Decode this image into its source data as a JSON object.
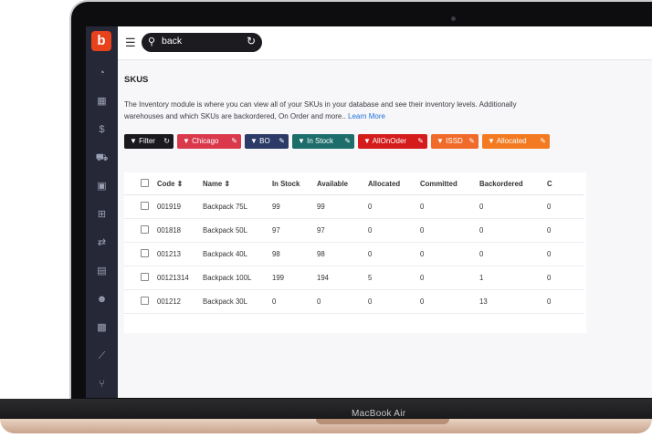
{
  "device": {
    "label": "MacBook Air"
  },
  "app": {
    "logo_letter": "b"
  },
  "search": {
    "value": "back"
  },
  "page": {
    "title": "SKUS",
    "description_line1": "The Inventory module is where you can view all of your SKUs in your database and see their inventory levels. Additionally",
    "description_line2": "warehouses and which SKUs are backordered, On Order and more..",
    "learn_more": "Learn More"
  },
  "filters": {
    "filter_label": "Filter",
    "chips": [
      {
        "label": "Chicago",
        "color": "#d9394b"
      },
      {
        "label": "BO",
        "color": "#2b3a66"
      },
      {
        "label": "In Stock",
        "color": "#1d6d6b"
      },
      {
        "label": "AllOnOder",
        "color": "#d51c1c"
      },
      {
        "label": "ISSD",
        "color": "#f06b2a"
      },
      {
        "label": "Allocated",
        "color": "#f37a20"
      }
    ]
  },
  "table": {
    "headers": [
      "Code",
      "Name",
      "In Stock",
      "Available",
      "Allocated",
      "Committed",
      "Backordered",
      "C"
    ],
    "rows": [
      [
        "001919",
        "Backpack 75L",
        "99",
        "99",
        "0",
        "0",
        "0",
        "0"
      ],
      [
        "001818",
        "Backpack 50L",
        "97",
        "97",
        "0",
        "0",
        "0",
        "0"
      ],
      [
        "001213",
        "Backpack 40L",
        "98",
        "98",
        "0",
        "0",
        "0",
        "0"
      ],
      [
        "00121314",
        "Backpack 100L",
        "199",
        "194",
        "5",
        "0",
        "1",
        "0"
      ],
      [
        "001212",
        "Backpack 30L",
        "0",
        "0",
        "0",
        "0",
        "13",
        "0"
      ]
    ]
  }
}
